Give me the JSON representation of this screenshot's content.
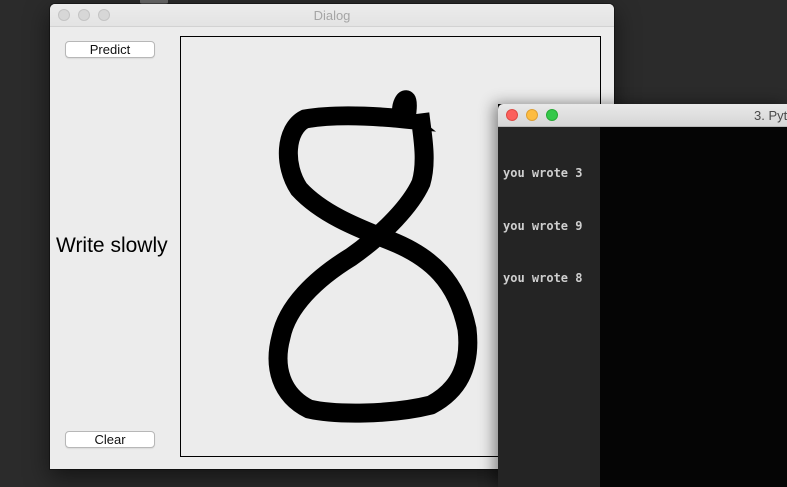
{
  "dialog": {
    "title": "Dialog",
    "predict_label": "Predict",
    "clear_label": "Clear",
    "hint_label": "Write slowly",
    "drawn_digit": "8"
  },
  "terminal": {
    "title": "3. Pyt",
    "lines": [
      "you wrote 3",
      "you wrote 9",
      "you wrote 8"
    ]
  }
}
